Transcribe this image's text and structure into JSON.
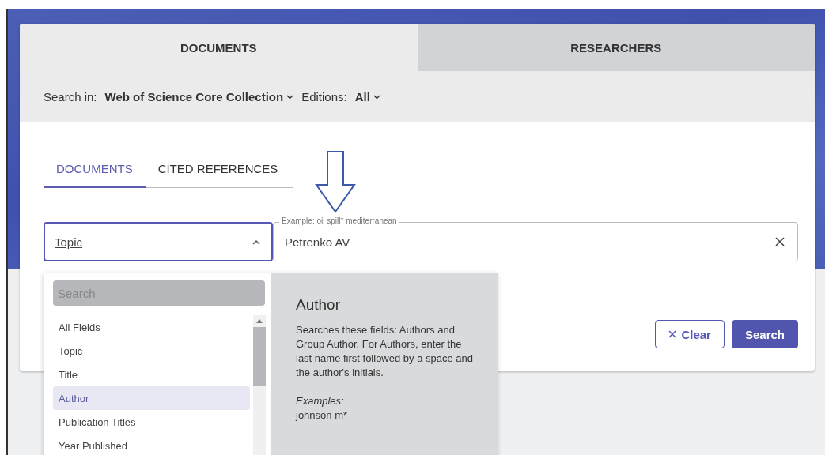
{
  "main_tabs": [
    {
      "label": "DOCUMENTS",
      "selected": true
    },
    {
      "label": "RESEARCHERS",
      "selected": false
    }
  ],
  "search_in": {
    "label": "Search in:",
    "value": "Web of Science Core Collection"
  },
  "editions": {
    "label": "Editions:",
    "value": "All"
  },
  "sub_tabs": [
    {
      "label": "DOCUMENTS",
      "selected": true
    },
    {
      "label": "CITED REFERENCES",
      "selected": false
    }
  ],
  "field_select": {
    "value": "Topic",
    "expanded": true
  },
  "query": {
    "label": "Example: oil spill* mediterranean",
    "value": "Petrenko AV"
  },
  "dropdown": {
    "search_placeholder": "Search",
    "options": [
      {
        "label": "All Fields",
        "selected": false
      },
      {
        "label": "Topic",
        "selected": false
      },
      {
        "label": "Title",
        "selected": false
      },
      {
        "label": "Author",
        "selected": true
      },
      {
        "label": "Publication Titles",
        "selected": false
      },
      {
        "label": "Year Published",
        "selected": false
      }
    ]
  },
  "help": {
    "title": "Author",
    "text": "Searches these fields: Authors and Group Author. For Authors, enter the last name first followed by a space and the author's initials.",
    "examples_label": "Examples:",
    "example": "johnson m*"
  },
  "buttons": [
    {
      "kind": "clear",
      "label": "Clear"
    },
    {
      "kind": "primary",
      "label": "Search"
    }
  ]
}
